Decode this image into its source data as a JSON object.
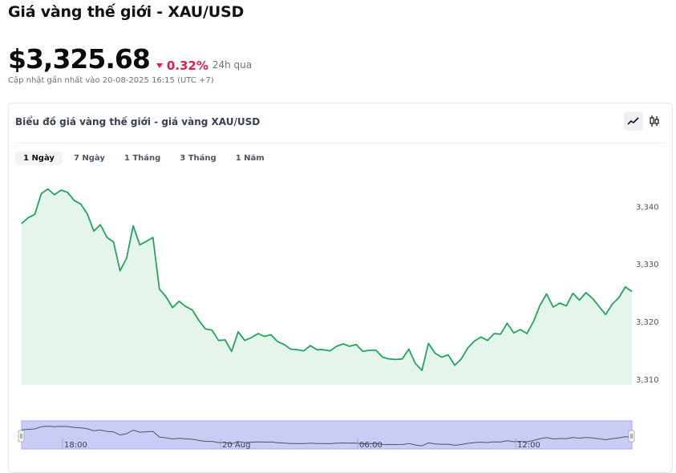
{
  "header": {
    "title": "Giá vàng thế giới - XAU/USD",
    "price": "$3,325.68",
    "change": "0.32%",
    "period": "24h qua",
    "updated": "Cập nhật gần nhất vào 20-08-2025 16:15 (UTC +7)"
  },
  "card": {
    "title": "Biểu đồ giá vàng thế giới - giá vàng XAU/USD",
    "chart_types": [
      {
        "name": "line",
        "icon": "line-chart-icon",
        "active": true
      },
      {
        "name": "candlestick",
        "icon": "candlestick-icon",
        "active": false
      }
    ],
    "ranges": [
      {
        "label": "1 Ngày",
        "active": true
      },
      {
        "label": "7 Ngày",
        "active": false
      },
      {
        "label": "1 Tháng",
        "active": false
      },
      {
        "label": "3 Tháng",
        "active": false
      },
      {
        "label": "1 Năm",
        "active": false
      }
    ]
  },
  "colors": {
    "line": "#22a55b",
    "area": "#e6f5ea",
    "down": "#e11d48",
    "navigator": "#c9cdf5"
  },
  "chart_data": {
    "type": "area",
    "series": [
      {
        "name": "",
        "values": [
          3337,
          3338,
          3338.6,
          3342.2,
          3343,
          3342,
          3342.8,
          3342.4,
          3341,
          3340.4,
          3338.7,
          3335.7,
          3336.8,
          3334.6,
          3333.8,
          3328.8,
          3331,
          3336.6,
          3333.3,
          3333.9,
          3334.6,
          3325.6,
          3324.3,
          3322.4,
          3323.5,
          3322.6,
          3322,
          3320.2,
          3318.7,
          3318.5,
          3316.7,
          3316.8,
          3314.8,
          3318.2,
          3316.7,
          3317.2,
          3317.9,
          3317.4,
          3317.7,
          3316.5,
          3316,
          3315.2,
          3315.1,
          3314.9,
          3315.8,
          3315.1,
          3315.1,
          3314.9,
          3315.7,
          3316.1,
          3315.7,
          3316,
          3314.8,
          3315,
          3315,
          3313.8,
          3313.5,
          3313.4,
          3313.5,
          3315.2,
          3312.7,
          3311.5,
          3316.2,
          3314.5,
          3313.8,
          3314.2,
          3312.4,
          3313.5,
          3315.4,
          3316.6,
          3317.3,
          3316.7,
          3317.9,
          3317.8,
          3319.7,
          3318,
          3318.6,
          3317.9,
          3320,
          3322.8,
          3324.8,
          3322.5,
          3323.2,
          3322.7,
          3324.9,
          3323.7,
          3325,
          3324,
          3322.6,
          3321.2,
          3323,
          3324.1,
          3326,
          3325.2
        ]
      }
    ],
    "y_ticks": [
      "3,340",
      "3,330",
      "3,320",
      "3,310"
    ],
    "ylim": [
      3309,
      3346.3
    ],
    "navigator_labels": [
      "18:00",
      "20 Aug",
      "06:00",
      "12:00"
    ],
    "grid": false,
    "legend": "none"
  }
}
